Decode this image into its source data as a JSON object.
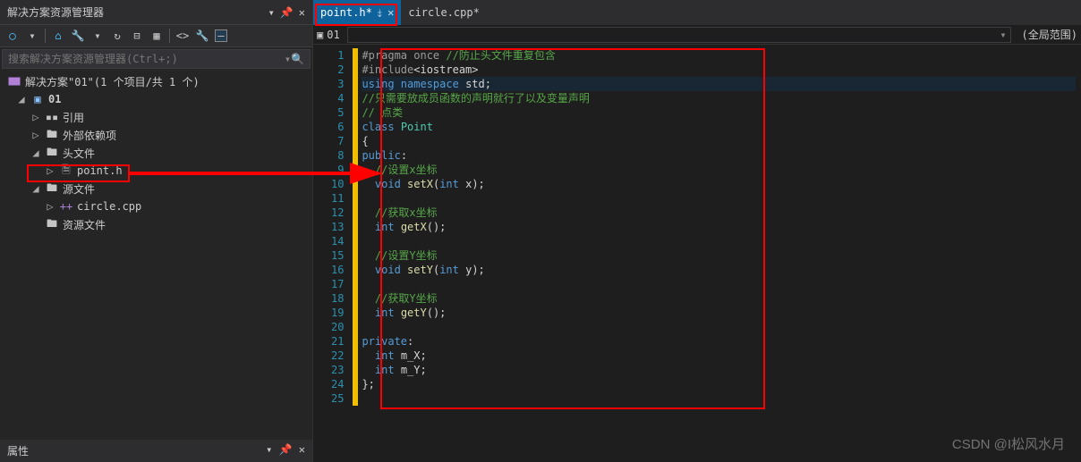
{
  "panel": {
    "title": "解决方案资源管理器",
    "search_placeholder": "搜索解决方案资源管理器(Ctrl+;)",
    "props_title": "属性"
  },
  "tree": {
    "solution": "解决方案\"01\"(1 个项目/共 1 个)",
    "project": "01",
    "references": "引用",
    "external": "外部依赖项",
    "headers": "头文件",
    "point_h": "point.h",
    "sources": "源文件",
    "circle_cpp": "circle.cpp",
    "resources": "资源文件"
  },
  "tabs": {
    "active": "point.h*",
    "other": "circle.cpp*"
  },
  "subbar": {
    "project_dd": "01",
    "scope": "(全局范围)"
  },
  "code_lines": [
    {
      "n": 1,
      "html": "<span class='c-pp'>#pragma once</span> <span class='c-cm'>//防止头文件重复包含</span>"
    },
    {
      "n": 2,
      "html": "<span class='c-pp'>#include</span><span class='c-tx'>&lt;iostream&gt;</span>"
    },
    {
      "n": 3,
      "html": "<span class='c-kw'>using namespace</span> <span class='c-tx'>std;</span>",
      "hl": true
    },
    {
      "n": 4,
      "html": "<span class='c-cm'>//只需要放成员函数的声明就行了以及变量声明</span>"
    },
    {
      "n": 5,
      "html": "<span class='c-cm'>// 点类</span>"
    },
    {
      "n": 6,
      "html": "<span class='c-kw'>class</span> <span class='c-ty'>Point</span>"
    },
    {
      "n": 7,
      "html": "<span class='c-br'>{</span>"
    },
    {
      "n": 8,
      "html": "<span class='c-kw'>public</span><span class='c-tx'>:</span>"
    },
    {
      "n": 9,
      "html": "  <span class='c-cm'>//设置x坐标</span>"
    },
    {
      "n": 10,
      "html": "  <span class='c-kw'>void</span> <span class='c-fn'>setX</span><span class='c-tx'>(</span><span class='c-kw'>int</span> <span class='c-tx'>x);</span>"
    },
    {
      "n": 11,
      "html": ""
    },
    {
      "n": 12,
      "html": "  <span class='c-cm'>//获取x坐标</span>"
    },
    {
      "n": 13,
      "html": "  <span class='c-kw'>int</span> <span class='c-fn'>getX</span><span class='c-tx'>();</span>"
    },
    {
      "n": 14,
      "html": ""
    },
    {
      "n": 15,
      "html": "  <span class='c-cm'>//设置Y坐标</span>"
    },
    {
      "n": 16,
      "html": "  <span class='c-kw'>void</span> <span class='c-fn'>setY</span><span class='c-tx'>(</span><span class='c-kw'>int</span> <span class='c-tx'>y);</span>"
    },
    {
      "n": 17,
      "html": ""
    },
    {
      "n": 18,
      "html": "  <span class='c-cm'>//获取Y坐标</span>"
    },
    {
      "n": 19,
      "html": "  <span class='c-kw'>int</span> <span class='c-fn'>getY</span><span class='c-tx'>();</span>"
    },
    {
      "n": 20,
      "html": ""
    },
    {
      "n": 21,
      "html": "<span class='c-kw'>private</span><span class='c-tx'>:</span>"
    },
    {
      "n": 22,
      "html": "  <span class='c-kw'>int</span> <span class='c-tx'>m_X;</span>"
    },
    {
      "n": 23,
      "html": "  <span class='c-kw'>int</span> <span class='c-tx'>m_Y;</span>"
    },
    {
      "n": 24,
      "html": "<span class='c-br'>};</span>"
    },
    {
      "n": 25,
      "html": ""
    }
  ],
  "watermark": "CSDN @I松风水月"
}
